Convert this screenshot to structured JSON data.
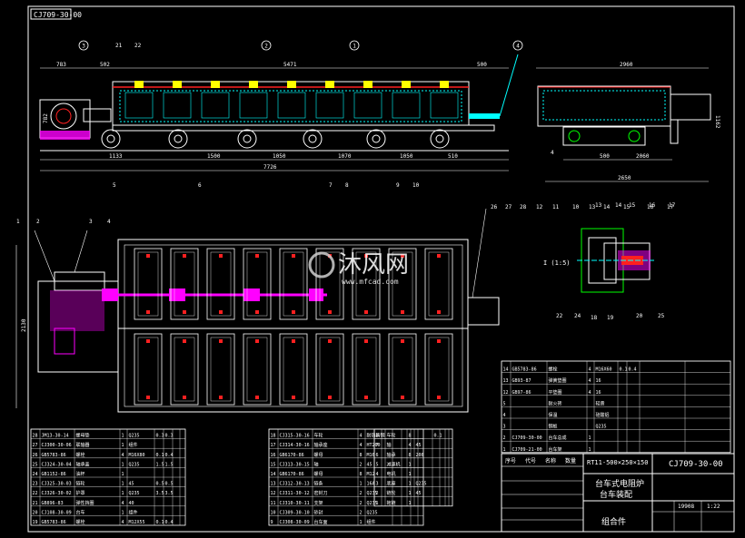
{
  "drawing_code_top": "CJ709-30-00",
  "watermark": {
    "brand": "沐风网",
    "url": "www.mfcad.com"
  },
  "balloons_top": [
    "3",
    "21",
    "22",
    "2",
    "1",
    "4"
  ],
  "balloons_bottom": [
    "5",
    "6",
    "7",
    "8",
    "9",
    "10"
  ],
  "balloons_side_bottom": [
    "4",
    "13",
    "14",
    "15",
    "16",
    "17"
  ],
  "balloons_plan": [
    "1",
    "2",
    "3",
    "4"
  ],
  "balloons_detail_top": [
    "26",
    "27",
    "28",
    "12",
    "11",
    "10",
    "13",
    "14",
    "15",
    "16",
    "17"
  ],
  "balloons_detail_bottom": [
    "22",
    "24",
    "18",
    "19",
    "20",
    "25"
  ],
  "dims_front_top": [
    "783",
    "502",
    "5471",
    "500"
  ],
  "dims_front_left": "782",
  "dims_front_bottom": [
    "1133",
    "1500",
    "1050",
    "1070",
    "1050",
    "510"
  ],
  "dims_front_total": "7726",
  "dims_side_top": "2960",
  "dims_side_right": "1162",
  "dims_side_bottom": [
    "500",
    "2060",
    "2650"
  ],
  "dims_plan_left": "2130",
  "detail_label": "I (1:5)",
  "bom_left_rows": [
    [
      "28",
      "JM13-30-14",
      "螺母垫",
      "1",
      "Q235",
      "0.3",
      "0.3",
      "",
      ""
    ],
    [
      "27",
      "CJ300-30-06",
      "联轴器",
      "1",
      "组件",
      "",
      "",
      "",
      ""
    ],
    [
      "26",
      "GB5783-86",
      "螺栓",
      "4",
      "M16X80",
      "0.1",
      "0.4",
      "",
      ""
    ],
    [
      "25",
      "CJ324-30-04",
      "轴承盖",
      "1",
      "Q235",
      "1.5",
      "1.5",
      "",
      ""
    ],
    [
      "24",
      "GB1152-86",
      "油杯",
      "1",
      "",
      "",
      "",
      "",
      ""
    ],
    [
      "23",
      "CJ325-30-03",
      "链轮",
      "1",
      "45",
      "0.5",
      "0.5",
      "",
      ""
    ],
    [
      "22",
      "CJ326-30-02",
      "护罩",
      "1",
      "Q235",
      "3.5",
      "3.5",
      "",
      ""
    ],
    [
      "21",
      "GB896-83",
      "弹性挡圈",
      "4",
      "40",
      "",
      "",
      "",
      ""
    ],
    [
      "20",
      "CJ108-30-09",
      "台车",
      "1",
      "组件",
      "",
      "",
      "",
      ""
    ],
    [
      "19",
      "GB5783-86",
      "螺栓",
      "4",
      "M12X55",
      "0.1",
      "0.4",
      "",
      ""
    ]
  ],
  "bom_mid_rows": [
    [
      "18",
      "CJ315-30-16",
      "车轮",
      "4",
      "耐热铸钢",
      "",
      "",
      "",
      ""
    ],
    [
      "17",
      "CJ314-30-16",
      "轴承座",
      "4",
      "HT200",
      "",
      "",
      "",
      ""
    ],
    [
      "16",
      "GB6170-86",
      "螺母",
      "8",
      "M16",
      "",
      "",
      "",
      ""
    ],
    [
      "15",
      "CJ313-30-15",
      "轴",
      "2",
      "45",
      "",
      "",
      "",
      ""
    ],
    [
      "14",
      "GB6170-86",
      "螺母",
      "8",
      "M12",
      "",
      "",
      "",
      ""
    ],
    [
      "13",
      "CJ312-30-13",
      "链条",
      "1",
      "16A",
      "",
      "",
      "",
      ""
    ],
    [
      "12",
      "CJ311-30-12",
      "密封刀",
      "2",
      "Q235",
      "",
      "",
      "",
      ""
    ],
    [
      "11",
      "CJ310-30-11",
      "支架",
      "2",
      "Q235",
      "",
      "",
      "",
      ""
    ],
    [
      "10",
      "CJ309-30-10",
      "砂封",
      "2",
      "Q235",
      "",
      "",
      "",
      ""
    ],
    [
      "9",
      "CJ308-30-09",
      "台车面",
      "1",
      "组件",
      "",
      "",
      "",
      ""
    ]
  ],
  "bom_right_rows": [
    [
      "8",
      "",
      "车轮",
      "8",
      "",
      "0.1",
      "",
      "",
      ""
    ],
    [
      "7",
      "",
      "轴",
      "4",
      "45",
      "",
      "",
      "",
      ""
    ],
    [
      "6",
      "",
      "轴承",
      "8",
      "208",
      "",
      "",
      "",
      ""
    ],
    [
      "5",
      "",
      "减速机",
      "1",
      "",
      "",
      "",
      "",
      ""
    ],
    [
      "4",
      "",
      "电机",
      "1",
      "",
      "",
      "",
      "",
      ""
    ],
    [
      "3",
      "",
      "底座",
      "1",
      "Q235",
      "",
      "",
      "",
      ""
    ],
    [
      "2",
      "",
      "链轮",
      "1",
      "45",
      "",
      "",
      "",
      ""
    ],
    [
      "1",
      "",
      "拖链",
      "1",
      "",
      "",
      "",
      "",
      ""
    ]
  ],
  "bom_top_rows": [
    [
      "14",
      "GB5783-86",
      "螺栓",
      "4",
      "M16X60",
      "0.1",
      "0.4",
      "",
      ""
    ],
    [
      "13",
      "GB93-87",
      "弹簧垫圈",
      "4",
      "16",
      "",
      "",
      "",
      ""
    ],
    [
      "12",
      "GB97-86",
      "平垫圈",
      "4",
      "16",
      "",
      "",
      "",
      ""
    ],
    [
      "5",
      "",
      "耐火砖",
      "",
      "轻质",
      "",
      "",
      "",
      ""
    ],
    [
      "4",
      "",
      "保温",
      "",
      "硅酸铝",
      "",
      "",
      "",
      ""
    ],
    [
      "3",
      "",
      "钢板",
      "",
      "Q235",
      "",
      "",
      "",
      ""
    ],
    [
      "2",
      "CJ709-30-00",
      "台车总成",
      "1",
      "",
      "",
      "",
      "",
      ""
    ],
    [
      "1",
      "CJ709-21-00",
      "台车架",
      "1",
      "",
      "",
      "",
      "",
      ""
    ]
  ],
  "bom_header": [
    "序号",
    "代号",
    "名称",
    "数量",
    "材料",
    "单件",
    "总计",
    "备注"
  ],
  "title_block": {
    "furnace": "RT11-500×250×150",
    "name_1": "台车式电阻炉",
    "name_2": "台车装配",
    "assembly": "组合件",
    "drawing_no": "CJ709-30-00",
    "weight": "19908",
    "scale": "1:22"
  },
  "colors": {
    "line": "#ffffff",
    "heater": "#00ffff",
    "bolt": "#ffff00",
    "rail": "#ff00ff",
    "red": "#ff2020",
    "green": "#00ff00"
  }
}
